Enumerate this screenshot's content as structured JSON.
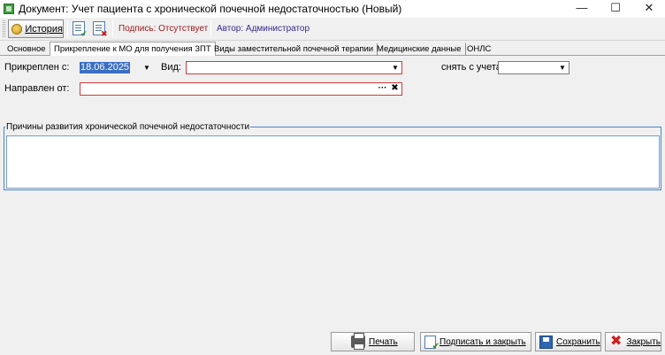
{
  "window": {
    "title": "Документ: Учет пациента с хронической почечной недостаточностью (Новый)",
    "minimize_glyph": "—",
    "maximize_glyph": "☐",
    "close_glyph": "✕"
  },
  "toolbar": {
    "history_label": "История",
    "signature_label": "Подпись: Отсутствует",
    "author_label": "Автор: Администратор",
    "icons": [
      "history-icon",
      "sign-document-icon",
      "remove-signature-icon"
    ]
  },
  "tabs": [
    {
      "label": "Основное",
      "active": false
    },
    {
      "label": "Прикрепление к МО для получения ЗПТ",
      "active": true
    },
    {
      "label": "Виды заместительной почечной терапии",
      "active": false
    },
    {
      "label": "Медицинские данные",
      "active": false
    },
    {
      "label": "ОНЛС",
      "active": false
    }
  ],
  "form": {
    "attached_from_label": "Прикреплен с:",
    "attached_from_value": "18.06.2025",
    "type_label": "Вид:",
    "type_value": "",
    "deregister_label": "снять с учета:",
    "deregister_value": "",
    "referred_from_label": "Направлен от:",
    "referred_from_value": "",
    "ellipsis_glyph": "···",
    "clear_glyph": "✖",
    "dropdown_glyph": "▼"
  },
  "reasons": {
    "legend": "Причины развития хронической почечной недостаточности",
    "value": ""
  },
  "buttons": {
    "print": "Печать",
    "sign_close": "Подписать и закрыть",
    "save": "Сохранить",
    "close": "Закрыть"
  },
  "colors": {
    "required_border": "#d23a3a",
    "selection": "#3a6ec4",
    "signature_text": "#a0191e",
    "author_text": "#3a2a8c",
    "fieldset_border": "#4a86c8"
  }
}
